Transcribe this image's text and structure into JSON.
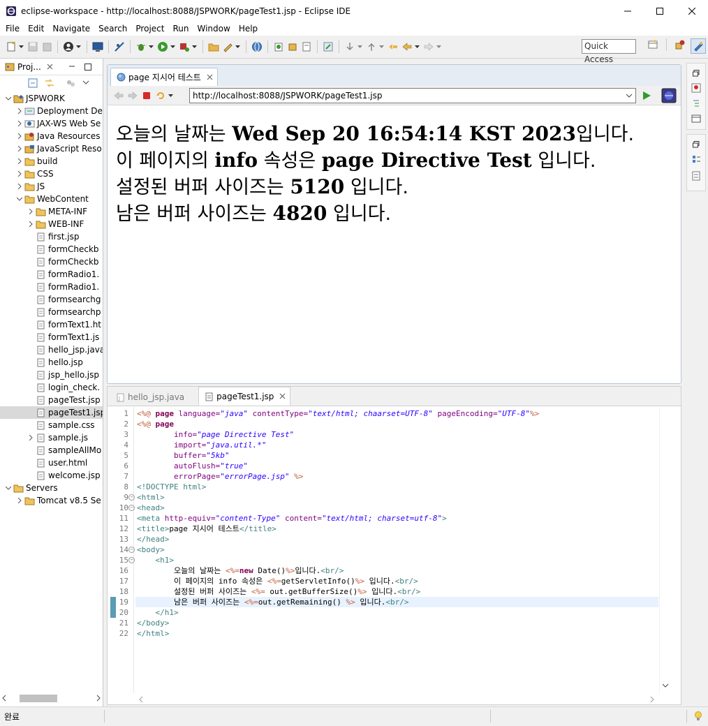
{
  "window": {
    "title": "eclipse-workspace - http://localhost:8088/JSPWORK/pageTest1.jsp - Eclipse IDE",
    "minimize_icon": "minimize-icon",
    "maximize_icon": "maximize-icon",
    "close_icon": "close-icon"
  },
  "menubar": {
    "items": [
      "File",
      "Edit",
      "Navigate",
      "Search",
      "Project",
      "Run",
      "Window",
      "Help"
    ]
  },
  "toolbar": {
    "quick_access": "Quick Access"
  },
  "project_explorer": {
    "tab_label": "Proj...",
    "tree": [
      {
        "label": "JSPWORK",
        "depth": 0,
        "expanded": true,
        "icon": "project-icon"
      },
      {
        "label": "Deployment De",
        "depth": 1,
        "expanded": false,
        "icon": "deployment-icon"
      },
      {
        "label": "JAX-WS Web Se",
        "depth": 1,
        "expanded": false,
        "icon": "webservice-icon"
      },
      {
        "label": "Java Resources",
        "depth": 1,
        "expanded": false,
        "icon": "java-resources-icon"
      },
      {
        "label": "JavaScript Reso",
        "depth": 1,
        "expanded": false,
        "icon": "javascript-resources-icon"
      },
      {
        "label": "build",
        "depth": 1,
        "expanded": false,
        "icon": "folder-icon"
      },
      {
        "label": "CSS",
        "depth": 1,
        "expanded": false,
        "icon": "folder-icon"
      },
      {
        "label": "JS",
        "depth": 1,
        "expanded": false,
        "icon": "folder-icon"
      },
      {
        "label": "WebContent",
        "depth": 1,
        "expanded": true,
        "icon": "folder-icon"
      },
      {
        "label": "META-INF",
        "depth": 2,
        "expanded": false,
        "icon": "folder-icon"
      },
      {
        "label": "WEB-INF",
        "depth": 2,
        "expanded": false,
        "icon": "folder-icon"
      },
      {
        "label": "first.jsp",
        "depth": 2,
        "icon": "file-icon"
      },
      {
        "label": "formCheckb",
        "depth": 2,
        "icon": "file-icon"
      },
      {
        "label": "formCheckb",
        "depth": 2,
        "icon": "file-icon"
      },
      {
        "label": "formRadio1.",
        "depth": 2,
        "icon": "file-icon"
      },
      {
        "label": "formRadio1.",
        "depth": 2,
        "icon": "file-icon"
      },
      {
        "label": "formsearchg",
        "depth": 2,
        "icon": "file-icon"
      },
      {
        "label": "formsearchp",
        "depth": 2,
        "icon": "file-icon"
      },
      {
        "label": "formText1.ht",
        "depth": 2,
        "icon": "file-icon"
      },
      {
        "label": "formText1.js",
        "depth": 2,
        "icon": "file-icon"
      },
      {
        "label": "hello_jsp.java",
        "depth": 2,
        "icon": "file-icon"
      },
      {
        "label": "hello.jsp",
        "depth": 2,
        "icon": "file-icon"
      },
      {
        "label": "jsp_hello.jsp",
        "depth": 2,
        "icon": "file-icon"
      },
      {
        "label": "login_check.",
        "depth": 2,
        "icon": "file-icon"
      },
      {
        "label": "pageTest.jsp",
        "depth": 2,
        "icon": "file-icon"
      },
      {
        "label": "pageTest1.jsp",
        "depth": 2,
        "icon": "file-icon",
        "selected": true
      },
      {
        "label": "sample.css",
        "depth": 2,
        "icon": "file-icon"
      },
      {
        "label": "sample.js",
        "depth": 2,
        "expanded": false,
        "icon": "file-icon"
      },
      {
        "label": "sampleAllMo",
        "depth": 2,
        "icon": "file-icon"
      },
      {
        "label": "user.html",
        "depth": 2,
        "icon": "file-icon"
      },
      {
        "label": "welcome.jsp",
        "depth": 2,
        "icon": "file-icon"
      },
      {
        "label": "Servers",
        "depth": 0,
        "expanded": true,
        "icon": "folder-icon"
      },
      {
        "label": "Tomcat v8.5 Se",
        "depth": 1,
        "expanded": false,
        "icon": "folder-icon"
      }
    ]
  },
  "browser": {
    "tab_label": "page 지시어 테스트",
    "url": "http://localhost:8088/JSPWORK/pageTest1.jsp",
    "content": [
      [
        {
          "t": "오늘의 날짜는 ",
          "ko": true
        },
        {
          "t": "Wed Sep 20 16:54:14 KST 2023",
          "ko": false
        },
        {
          "t": "입니다.",
          "ko": true
        }
      ],
      [
        {
          "t": "이 페이지의 ",
          "ko": true
        },
        {
          "t": "info",
          "ko": false
        },
        {
          "t": " 속성은 ",
          "ko": true
        },
        {
          "t": "page Directive Test",
          "ko": false
        },
        {
          "t": " 입니다.",
          "ko": true
        }
      ],
      [
        {
          "t": "설정된 버퍼 사이즈는 ",
          "ko": true
        },
        {
          "t": "5120",
          "ko": false
        },
        {
          "t": " 입니다.",
          "ko": true
        }
      ],
      [
        {
          "t": "남은 버퍼 사이즈는 ",
          "ko": true
        },
        {
          "t": "4820",
          "ko": false
        },
        {
          "t": " 입니다.",
          "ko": true
        }
      ]
    ]
  },
  "editor": {
    "tabs": [
      {
        "label": "hello_jsp.java",
        "active": false
      },
      {
        "label": "pageTest1.jsp",
        "active": true
      }
    ],
    "highlighted_line": 19,
    "fold_lines": [
      9,
      10,
      14,
      15
    ],
    "lines": [
      [
        [
          "dir",
          "<%@ "
        ],
        [
          "kw",
          "page"
        ],
        [
          "attr",
          " language="
        ],
        [
          "str",
          "\"java\""
        ],
        [
          "attr",
          " contentType="
        ],
        [
          "str",
          "\"text/html; chaarset=UTF-8\""
        ],
        [
          "attr",
          " pageEncoding="
        ],
        [
          "str",
          "\"UTF-8\""
        ],
        [
          "dir",
          "%>"
        ]
      ],
      [
        [
          "dir",
          "<%@ "
        ],
        [
          "kw",
          "page"
        ]
      ],
      [
        [
          "txt",
          "        "
        ],
        [
          "attr",
          "info="
        ],
        [
          "str",
          "\"page Directive Test\""
        ]
      ],
      [
        [
          "txt",
          "        "
        ],
        [
          "attr",
          "import="
        ],
        [
          "str",
          "\"java.util.*\""
        ]
      ],
      [
        [
          "txt",
          "        "
        ],
        [
          "attr",
          "buffer="
        ],
        [
          "str",
          "\"5kb\""
        ]
      ],
      [
        [
          "txt",
          "        "
        ],
        [
          "attr",
          "autoFlush="
        ],
        [
          "str",
          "\"true\""
        ]
      ],
      [
        [
          "txt",
          "        "
        ],
        [
          "attr",
          "errorPage="
        ],
        [
          "str",
          "\"errorPage.jsp\""
        ],
        [
          "dir",
          " %>"
        ]
      ],
      [
        [
          "tag",
          "<!DOCTYPE "
        ],
        [
          "el",
          "html"
        ],
        [
          "tag",
          ">"
        ]
      ],
      [
        [
          "tag",
          "<"
        ],
        [
          "el",
          "html"
        ],
        [
          "tag",
          ">"
        ]
      ],
      [
        [
          "tag",
          "<"
        ],
        [
          "el",
          "head"
        ],
        [
          "tag",
          ">"
        ]
      ],
      [
        [
          "tag",
          "<"
        ],
        [
          "el",
          "meta"
        ],
        [
          "attr",
          " http-equiv="
        ],
        [
          "str",
          "\"content-Type\""
        ],
        [
          "attr",
          " content="
        ],
        [
          "str",
          "\"text/html; charset=utf-8\""
        ],
        [
          "tag",
          ">"
        ]
      ],
      [
        [
          "tag",
          "<"
        ],
        [
          "el",
          "title"
        ],
        [
          "tag",
          ">"
        ],
        [
          "txt",
          "page 지시어 테스트"
        ],
        [
          "tag",
          "</"
        ],
        [
          "el",
          "title"
        ],
        [
          "tag",
          ">"
        ]
      ],
      [
        [
          "tag",
          "</"
        ],
        [
          "el",
          "head"
        ],
        [
          "tag",
          ">"
        ]
      ],
      [
        [
          "tag",
          "<"
        ],
        [
          "el",
          "body"
        ],
        [
          "tag",
          ">"
        ]
      ],
      [
        [
          "txt",
          "    "
        ],
        [
          "tag",
          "<"
        ],
        [
          "el",
          "h1"
        ],
        [
          "tag",
          ">"
        ]
      ],
      [
        [
          "txt",
          "        오늘의 날짜는 "
        ],
        [
          "dir",
          "<%="
        ],
        [
          "kw",
          "new"
        ],
        [
          "txt",
          " Date()"
        ],
        [
          "dir",
          "%>"
        ],
        [
          "txt",
          "입니다."
        ],
        [
          "tag",
          "<"
        ],
        [
          "el",
          "br"
        ],
        [
          "tag",
          "/>"
        ]
      ],
      [
        [
          "txt",
          "        이 페이지의 info 속성은 "
        ],
        [
          "dir",
          "<%="
        ],
        [
          "txt",
          "getServletInfo()"
        ],
        [
          "dir",
          "%>"
        ],
        [
          "txt",
          " 입니다."
        ],
        [
          "tag",
          "<"
        ],
        [
          "el",
          "br"
        ],
        [
          "tag",
          "/>"
        ]
      ],
      [
        [
          "txt",
          "        설정된 버퍼 사이즈는 "
        ],
        [
          "dir",
          "<%="
        ],
        [
          "txt",
          " out.getBufferSize()"
        ],
        [
          "dir",
          "%>"
        ],
        [
          "txt",
          " 입니다."
        ],
        [
          "tag",
          "<"
        ],
        [
          "el",
          "br"
        ],
        [
          "tag",
          "/>"
        ]
      ],
      [
        [
          "txt",
          "        남은 버퍼 사이즈는 "
        ],
        [
          "dir",
          "<%="
        ],
        [
          "txt",
          "out.getRemaining() "
        ],
        [
          "dir",
          "%>"
        ],
        [
          "txt",
          " 입니다."
        ],
        [
          "tag",
          "<"
        ],
        [
          "el",
          "br"
        ],
        [
          "tag",
          "/>"
        ]
      ],
      [
        [
          "txt",
          "    "
        ],
        [
          "tag",
          "</"
        ],
        [
          "el",
          "h1"
        ],
        [
          "tag",
          ">"
        ]
      ],
      [
        [
          "tag",
          "</"
        ],
        [
          "el",
          "body"
        ],
        [
          "tag",
          ">"
        ]
      ],
      [
        [
          "tag",
          "</"
        ],
        [
          "el",
          "html"
        ],
        [
          "tag",
          ">"
        ]
      ]
    ]
  },
  "statusbar": {
    "text": "완료"
  }
}
